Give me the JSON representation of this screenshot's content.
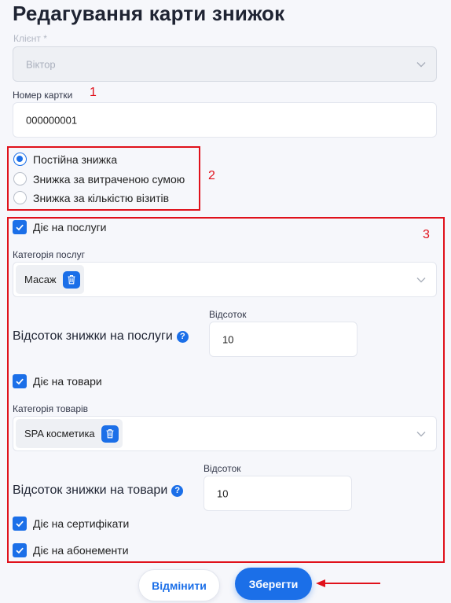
{
  "page": {
    "title": "Редагування карти знижок"
  },
  "client": {
    "label": "Клієнт *",
    "value": "Віктор"
  },
  "card_number": {
    "label": "Номер картки",
    "value": "000000001"
  },
  "discount_type": {
    "options": [
      {
        "label": "Постійна знижка",
        "selected": true
      },
      {
        "label": "Знижка за витраченою сумою",
        "selected": false
      },
      {
        "label": "Знижка за кількістю візитів",
        "selected": false
      }
    ]
  },
  "services": {
    "checkbox_label": "Діє на послуги",
    "category_label": "Категорія послуг",
    "chip": "Масаж",
    "percent_title": "Відсоток знижки на послуги",
    "percent_label": "Відсоток",
    "percent_value": "10"
  },
  "goods": {
    "checkbox_label": "Діє на товари",
    "category_label": "Категорія товарів",
    "chip": "SPA косметика",
    "percent_title": "Відсоток знижки на товари",
    "percent_label": "Відсоток",
    "percent_value": "10"
  },
  "certificates": {
    "checkbox_label": "Діє на сертифікати"
  },
  "subscriptions": {
    "checkbox_label": "Діє на абонементи"
  },
  "buttons": {
    "cancel": "Відмінити",
    "save": "Зберегти"
  },
  "annotations": {
    "n1": "1",
    "n2": "2",
    "n3": "3"
  },
  "icons": {
    "help": "question-icon",
    "trash": "trash-icon",
    "chevron": "chevron-down-icon",
    "check": "check-icon",
    "arrow": "arrow-left-icon"
  },
  "colors": {
    "accent": "#1b6fe8",
    "annotation": "#e0111b"
  }
}
